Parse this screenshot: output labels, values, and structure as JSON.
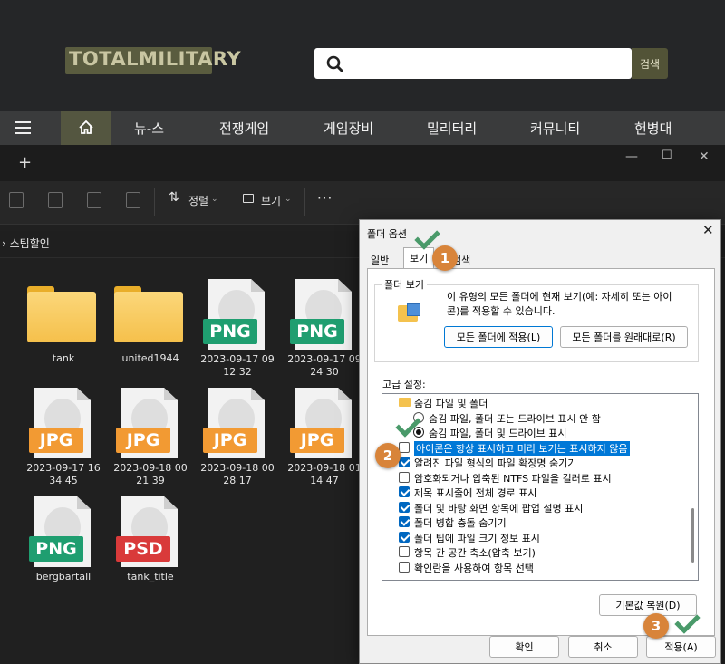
{
  "site": {
    "logo_text": "TOTALMILITARY",
    "search_placeholder": "",
    "search_button": "검색",
    "nav": [
      "뉴-스",
      "전쟁게임",
      "게임장비",
      "밀리터리",
      "커뮤니티",
      "헌병대"
    ]
  },
  "explorer": {
    "new_tab": "+",
    "toolbar": {
      "sort_label": "정렬",
      "view_label": "보기",
      "more_label": "···"
    },
    "breadcrumb": "스팀할인",
    "items": [
      {
        "type": "folder",
        "name": "tank"
      },
      {
        "type": "folder",
        "name": "united1944"
      },
      {
        "type": "file",
        "badge": "PNG",
        "name": "2023-09-17 09 12 32",
        "color": "#1f9e70"
      },
      {
        "type": "file",
        "badge": "PNG",
        "name": "2023-09-17 09 24 30",
        "color": "#1f9e70"
      },
      {
        "type": "file",
        "badge": "JPG",
        "name": "2023-09-17 16 34 45",
        "color": "#f29a33"
      },
      {
        "type": "file",
        "badge": "JPG",
        "name": "2023-09-18 00 21 39",
        "color": "#f29a33"
      },
      {
        "type": "file",
        "badge": "JPG",
        "name": "2023-09-18 00 28 17",
        "color": "#f29a33"
      },
      {
        "type": "file",
        "badge": "JPG",
        "name": "2023-09-18 01 14 47",
        "color": "#f29a33"
      },
      {
        "type": "file",
        "badge": "PNG",
        "name": "bergbartall",
        "color": "#1f9e70"
      },
      {
        "type": "file",
        "badge": "PSD",
        "name": "tank_title",
        "color": "#d93a3a"
      }
    ]
  },
  "dialog": {
    "title": "폴더 옵션",
    "tabs": [
      "일반",
      "보기",
      "검색"
    ],
    "folder_view_group": "폴더 보기",
    "folder_view_desc_1": "이 유형의 모든 폴더에 현재 보기(예: 자세히 또는 아이",
    "folder_view_desc_2": "콘)를 적용할 수 있습니다.",
    "apply_to_folders": "모든 폴더에 적용(L)",
    "reset_folders": "모든 폴더를 원래대로(R)",
    "advanced_label": "고급 설정:",
    "tree": [
      {
        "kind": "folder",
        "label": "숨김 파일 및 폴더",
        "indent": 1
      },
      {
        "kind": "radio",
        "checked": false,
        "label": "숨김 파일, 폴더 또는 드라이브 표시 안 함",
        "indent": 2
      },
      {
        "kind": "radio",
        "checked": true,
        "label": "숨김 파일, 폴더 및 드라이브 표시",
        "indent": 2
      },
      {
        "kind": "check",
        "checked": false,
        "label": "아이콘은 항상 표시하고 미리 보기는 표시하지 않음",
        "indent": 1,
        "highlight": true
      },
      {
        "kind": "check",
        "checked": true,
        "label": "알려진 파일 형식의 파일 확장명 숨기기",
        "indent": 1
      },
      {
        "kind": "check",
        "checked": false,
        "label": "암호화되거나 압축된 NTFS 파일을 컬러로 표시",
        "indent": 1
      },
      {
        "kind": "check",
        "checked": true,
        "label": "제목 표시줄에 전체 경로 표시",
        "indent": 1
      },
      {
        "kind": "check",
        "checked": true,
        "label": "폴더 및 바탕 화면 항목에 팝업 설명 표시",
        "indent": 1
      },
      {
        "kind": "check",
        "checked": true,
        "label": "폴더 병합 충돌 숨기기",
        "indent": 1
      },
      {
        "kind": "check",
        "checked": true,
        "label": "폴더 팁에 파일 크기 정보 표시",
        "indent": 1
      },
      {
        "kind": "check",
        "checked": false,
        "label": "항목 간 공간 축소(압축 보기)",
        "indent": 1
      },
      {
        "kind": "check",
        "checked": false,
        "label": "확인란을 사용하여 항목 선택",
        "indent": 1
      }
    ],
    "restore_defaults": "기본값 복원(D)",
    "ok": "확인",
    "cancel": "취소",
    "apply": "적용(A)"
  },
  "annotations": [
    "1",
    "2",
    "3"
  ],
  "colors": {
    "annotation": "#d8843a",
    "check": "#4a9a6a",
    "accent": "#0078d7"
  }
}
